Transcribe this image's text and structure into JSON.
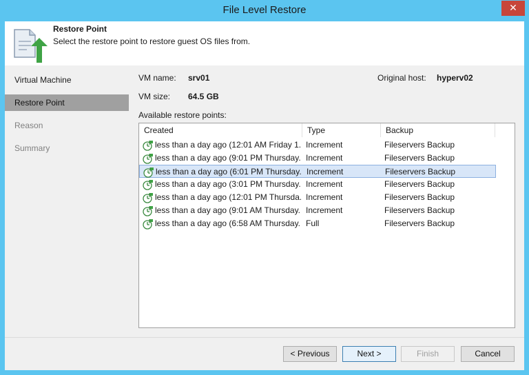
{
  "window": {
    "title": "File Level Restore",
    "close_glyph": "✕"
  },
  "header": {
    "title": "Restore Point",
    "subtitle": "Select the restore point to restore guest OS files from.",
    "icon": "restore-document-icon"
  },
  "steps": [
    {
      "label": "Virtual Machine",
      "state": "done"
    },
    {
      "label": "Restore Point",
      "state": "active"
    },
    {
      "label": "Reason",
      "state": "pending"
    },
    {
      "label": "Summary",
      "state": "pending"
    }
  ],
  "vm": {
    "name_label": "VM name:",
    "name": "srv01",
    "size_label": "VM size:",
    "size": "64.5 GB",
    "host_label": "Original host:",
    "host": "hyperv02"
  },
  "restore_points": {
    "label": "Available restore points:",
    "columns": [
      "Created",
      "Type",
      "Backup"
    ],
    "rows": [
      {
        "created": "less than a day ago (12:01 AM Friday 1...",
        "type": "Increment",
        "backup": "Fileservers Backup",
        "selected": false
      },
      {
        "created": "less than a day ago (9:01 PM Thursday...",
        "type": "Increment",
        "backup": "Fileservers Backup",
        "selected": false
      },
      {
        "created": "less than a day ago (6:01 PM Thursday...",
        "type": "Increment",
        "backup": "Fileservers Backup",
        "selected": true
      },
      {
        "created": "less than a day ago (3:01 PM Thursday...",
        "type": "Increment",
        "backup": "Fileservers Backup",
        "selected": false
      },
      {
        "created": "less than a day ago (12:01 PM Thursda...",
        "type": "Increment",
        "backup": "Fileservers Backup",
        "selected": false
      },
      {
        "created": "less than a day ago (9:01 AM Thursday...",
        "type": "Increment",
        "backup": "Fileservers Backup",
        "selected": false
      },
      {
        "created": "less than a day ago (6:58 AM Thursday...",
        "type": "Full",
        "backup": "Fileservers Backup",
        "selected": false
      }
    ]
  },
  "footer": {
    "previous": "< Previous",
    "next": "Next >",
    "finish": "Finish",
    "cancel": "Cancel"
  }
}
